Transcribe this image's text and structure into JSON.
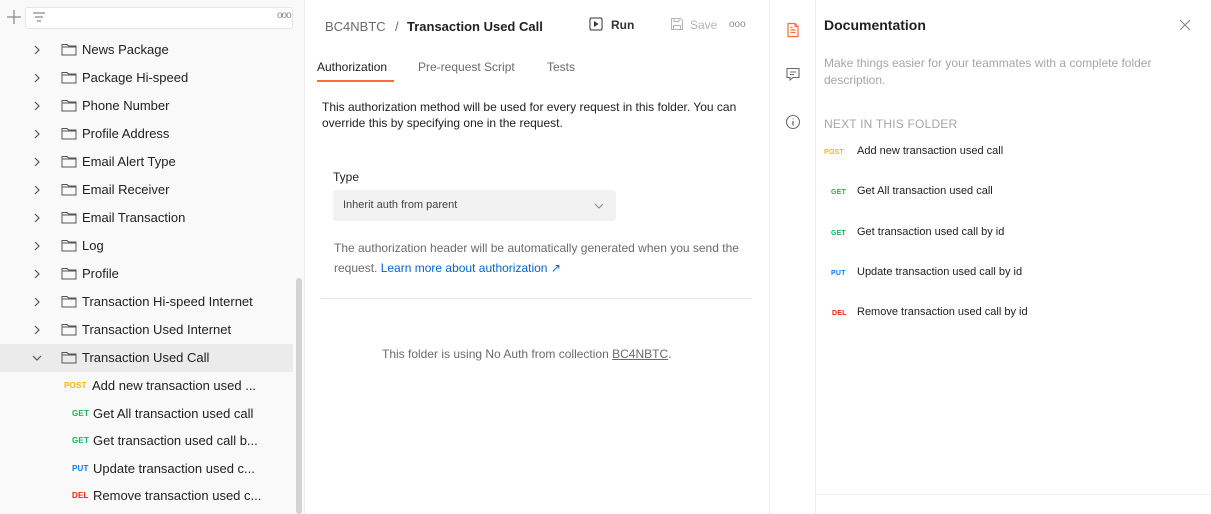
{
  "colors": {
    "accent": "#ff6c37",
    "link": "#0265d2",
    "post": "#ffb400",
    "get": "#0cbb52",
    "put": "#097bed",
    "del": "#eb2013"
  },
  "sidebar": {
    "folders": [
      {
        "label": "News Package",
        "expanded": false
      },
      {
        "label": "Package Hi-speed",
        "expanded": false
      },
      {
        "label": "Phone Number",
        "expanded": false
      },
      {
        "label": "Profile Address",
        "expanded": false
      },
      {
        "label": "Email Alert Type",
        "expanded": false
      },
      {
        "label": "Email Receiver",
        "expanded": false
      },
      {
        "label": "Email Transaction",
        "expanded": false
      },
      {
        "label": "Log",
        "expanded": false
      },
      {
        "label": "Profile",
        "expanded": false
      },
      {
        "label": "Transaction Hi-speed Internet",
        "expanded": false
      },
      {
        "label": "Transaction Used Internet",
        "expanded": false
      },
      {
        "label": "Transaction Used Call",
        "expanded": true
      }
    ],
    "requests": [
      {
        "method": "POST",
        "label": "Add new transaction used ..."
      },
      {
        "method": "GET",
        "label": "Get All transaction used call"
      },
      {
        "method": "GET",
        "label": "Get transaction used call b..."
      },
      {
        "method": "PUT",
        "label": "Update transaction used c..."
      },
      {
        "method": "DEL",
        "label": "Remove transaction used c..."
      }
    ]
  },
  "header": {
    "collection": "BC4NBTC",
    "separator": "/",
    "folder": "Transaction Used Call",
    "run_label": "Run",
    "save_label": "Save"
  },
  "tabs": [
    {
      "label": "Authorization",
      "active": true
    },
    {
      "label": "Pre-request Script",
      "active": false
    },
    {
      "label": "Tests",
      "active": false
    }
  ],
  "auth": {
    "description": "This authorization method will be used for every request in this folder. You can override this by specifying one in the request.",
    "type_label": "Type",
    "type_value": "Inherit auth from parent",
    "note": "The authorization header will be automatically generated when you send the request.",
    "learn_more": "Learn more about authorization ↗",
    "noauth_prefix": "This folder is using No Auth from collection",
    "noauth_link": "BC4NBTC",
    "noauth_suffix": "."
  },
  "documentation": {
    "title": "Documentation",
    "description": "Make things easier for your teammates with a complete folder description.",
    "next_heading": "NEXT IN THIS FOLDER",
    "items": [
      {
        "method": "POST",
        "label": "Add new transaction used call"
      },
      {
        "method": "GET",
        "label": "Get All transaction used call"
      },
      {
        "method": "GET",
        "label": "Get transaction used call by id"
      },
      {
        "method": "PUT",
        "label": "Update transaction used call by id"
      },
      {
        "method": "DEL",
        "label": "Remove transaction used call by id"
      }
    ]
  }
}
